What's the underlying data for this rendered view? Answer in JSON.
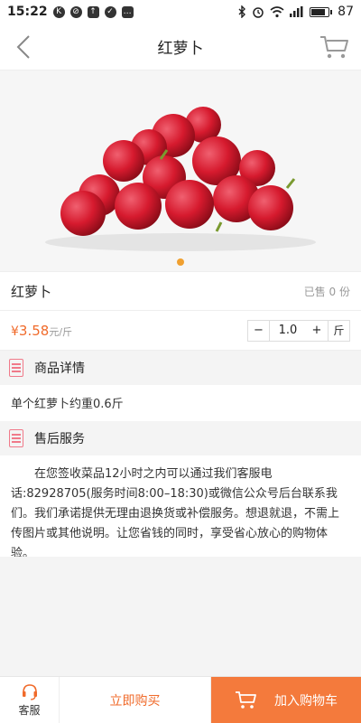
{
  "status_bar": {
    "time": "15:22",
    "battery": "87"
  },
  "nav": {
    "title": "红萝卜"
  },
  "product": {
    "name": "红萝卜",
    "sold": "已售 0 份",
    "currency": "¥",
    "price": "3.58",
    "unit": "元/斤",
    "quantity": "1.0",
    "qty_unit": "斤",
    "minus_label": "−",
    "plus_label": "+"
  },
  "details": {
    "title": "商品详情",
    "text": "单个红萝卜约重0.6斤"
  },
  "after_sales": {
    "title": "售后服务",
    "text": "在您签收菜品12小时之内可以通过我们客服电话:82928705(服务时间8:00–18:30)或微信公众号后台联系我们。我们承诺提供无理由退换货或补偿服务。想退就退，不需上传图片或其他说明。让您省钱的同时，享受省心放心的购物体验。"
  },
  "bottom_bar": {
    "service_label": "客服",
    "buy_label": "立即购买",
    "add_cart_label": "加入购物车"
  },
  "colors": {
    "accent": "#f47a3c",
    "price": "#f06a2a",
    "indicator": "#f0a030"
  }
}
